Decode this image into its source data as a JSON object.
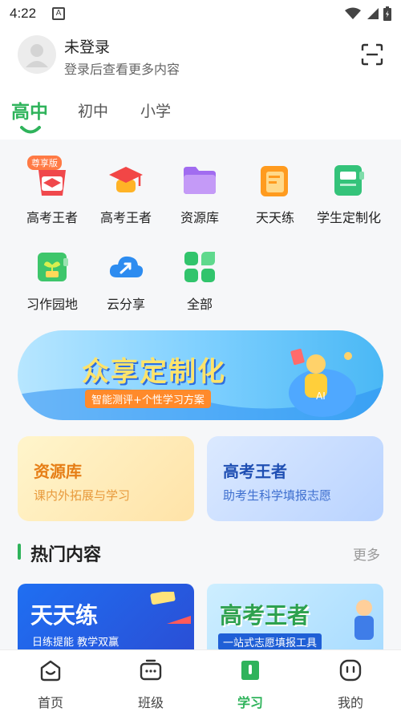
{
  "status_bar": {
    "time": "4:22",
    "notification_letter": "A"
  },
  "header": {
    "user_name": "未登录",
    "user_subtitle": "登录后查看更多内容"
  },
  "level_tabs": [
    {
      "label": "高中",
      "active": true
    },
    {
      "label": "初中",
      "active": false
    },
    {
      "label": "小学",
      "active": false
    }
  ],
  "tools": [
    {
      "label": "高考王者",
      "badge": "尊享版",
      "icon": "gaokao-premium-icon"
    },
    {
      "label": "高考王者",
      "icon": "graduation-cap-icon"
    },
    {
      "label": "资源库",
      "icon": "folder-icon"
    },
    {
      "label": "天天练",
      "icon": "daily-practice-icon"
    },
    {
      "label": "学生定制化",
      "icon": "custom-notebook-icon"
    },
    {
      "label": "习作园地",
      "icon": "sprout-icon"
    },
    {
      "label": "云分享",
      "icon": "cloud-share-icon"
    },
    {
      "label": "全部",
      "icon": "grid-all-icon"
    }
  ],
  "banner": {
    "title": "众享定制化",
    "subtitle": "智能测评+个性学习方案"
  },
  "cards": [
    {
      "title": "资源库",
      "subtitle": "课内外拓展与学习",
      "title_color": "#e67e16",
      "sub_color": "#e89a3c"
    },
    {
      "title": "高考王者",
      "subtitle": "助考生科学填报志愿",
      "title_color": "#1f4fb3",
      "sub_color": "#3e6fcf"
    }
  ],
  "hot": {
    "title": "热门内容",
    "more": "更多",
    "items": [
      {
        "title": "天天练",
        "subtitle": "日练提能  教学双赢"
      },
      {
        "title": "高考王者",
        "subtitle": "一站式志愿填报工具"
      }
    ]
  },
  "bottom_nav": [
    {
      "label": "首页",
      "icon": "home-icon",
      "active": false
    },
    {
      "label": "班级",
      "icon": "class-icon",
      "active": false
    },
    {
      "label": "学习",
      "icon": "study-icon",
      "active": true
    },
    {
      "label": "我的",
      "icon": "profile-icon",
      "active": false
    }
  ],
  "colors": {
    "accent": "#2fb35b",
    "background": "#f6f7f9"
  }
}
